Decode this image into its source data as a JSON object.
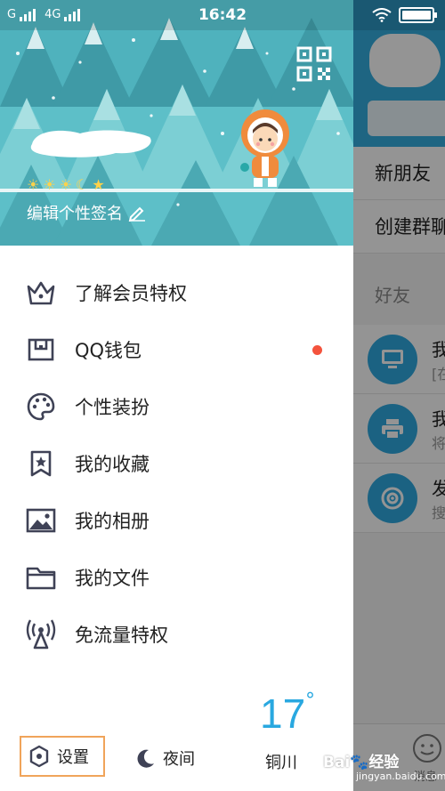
{
  "status_bar": {
    "carrier_left": "G",
    "network_type": "4G",
    "time": "16:42"
  },
  "drawer": {
    "profile": {
      "signature_label": "编辑个性签名",
      "level_icons": [
        "sun-icon",
        "sun-icon",
        "sun-icon",
        "moon-icon",
        "star-icon"
      ]
    },
    "menu": [
      {
        "label": "了解会员特权",
        "icon": "crown-icon"
      },
      {
        "label": "QQ钱包",
        "icon": "wallet-icon",
        "badge_color": "#f4533d"
      },
      {
        "label": "个性装扮",
        "icon": "palette-icon"
      },
      {
        "label": "我的收藏",
        "icon": "bookmark-star-icon"
      },
      {
        "label": "我的相册",
        "icon": "photo-icon"
      },
      {
        "label": "我的文件",
        "icon": "folder-icon"
      },
      {
        "label": "免流量特权",
        "icon": "signal-tower-icon"
      }
    ],
    "weather": {
      "temperature": "17",
      "degree_symbol": "°",
      "city": "铜川"
    },
    "bottom": {
      "settings_label": "设置",
      "night_label": "夜间"
    }
  },
  "background_screen": {
    "rows": [
      "新朋友",
      "创建群聊"
    ],
    "section_label": "好友",
    "items": [
      {
        "title": "我",
        "subtitle": "[在",
        "icon": "monitor-icon"
      },
      {
        "title": "我",
        "subtitle": "将",
        "icon": "printer-icon"
      },
      {
        "title": "发",
        "subtitle": "搜",
        "icon": "radar-icon"
      }
    ],
    "tab_label": "消息"
  },
  "watermark": {
    "text": "Bai🐾经验",
    "sub": "jingyan.baidu.com"
  },
  "colors": {
    "accent_blue": "#29a8e0",
    "header_teal": "#57bcc6",
    "settings_highlight": "#f0a45a"
  }
}
